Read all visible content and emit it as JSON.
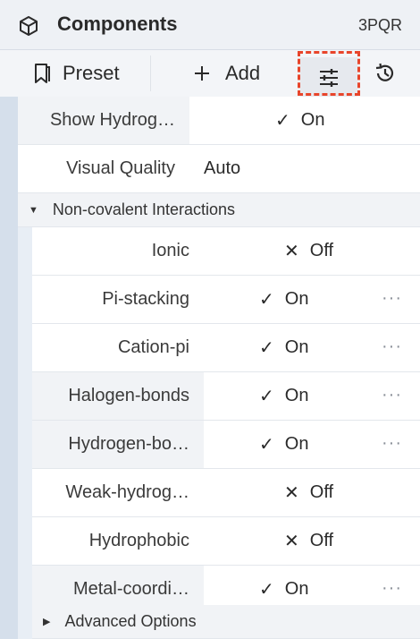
{
  "header": {
    "title": "Components",
    "pdb_id": "3PQR"
  },
  "toolbar": {
    "preset_label": "Preset",
    "add_label": "Add"
  },
  "top_rows": [
    {
      "label": "Show Hydrog…",
      "value": "On",
      "mark": "✓"
    },
    {
      "label": "Visual Quality",
      "value": "Auto"
    }
  ],
  "section": {
    "title": "Non-covalent Interactions"
  },
  "interactions": [
    {
      "label": "Ionic",
      "value": "Off",
      "mark": "✕"
    },
    {
      "label": "Pi-stacking",
      "value": "On",
      "mark": "✓",
      "more": "···"
    },
    {
      "label": "Cation-pi",
      "value": "On",
      "mark": "✓",
      "more": "···"
    },
    {
      "label": "Halogen-bonds",
      "value": "On",
      "mark": "✓",
      "more": "···"
    },
    {
      "label": "Hydrogen-bo…",
      "value": "On",
      "mark": "✓",
      "more": "···"
    },
    {
      "label": "Weak-hydrog…",
      "value": "Off",
      "mark": "✕"
    },
    {
      "label": "Hydrophobic",
      "value": "Off",
      "mark": "✕"
    },
    {
      "label": "Metal-coordi…",
      "value": "On",
      "mark": "✓",
      "more": "···"
    }
  ],
  "advanced": {
    "title": "Advanced Options"
  },
  "colors": {
    "accent_dashed": "#e8452b",
    "sidebar": "#d5dfeb"
  },
  "icons": [
    "cube-icon",
    "bookmark-icon",
    "plus-icon",
    "sliders-icon",
    "history-icon",
    "caret-down-icon",
    "caret-right-icon",
    "check-icon",
    "cross-icon",
    "more-icon"
  ]
}
